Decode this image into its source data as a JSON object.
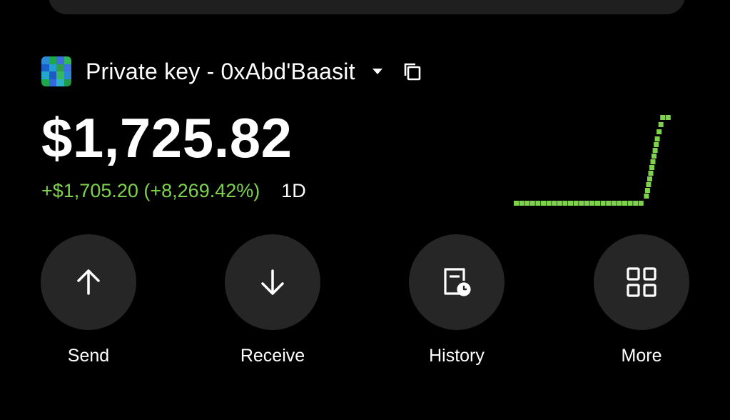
{
  "account": {
    "name": "Private key - 0xAbd'Baasit",
    "avatar_colors": [
      "#2b8bd9",
      "#1fa84a",
      "#3d6fe0",
      "#2fb85a",
      "#1a60c9",
      "#22a0d0",
      "#2e9c4d",
      "#3b73e6",
      "#24a7cf",
      "#1d5bc4",
      "#33b85f",
      "#2a87d6",
      "#1fa84a",
      "#3468de",
      "#2ab2c8",
      "#1e9b48"
    ]
  },
  "balance": "$1,725.82",
  "change": "+$1,705.20 (+8,269.42%)",
  "period": "1D",
  "accent_color": "#7dd34b",
  "actions": [
    {
      "label": "Send",
      "icon": "arrow-up-icon"
    },
    {
      "label": "Receive",
      "icon": "arrow-down-icon"
    },
    {
      "label": "History",
      "icon": "history-icon"
    },
    {
      "label": "More",
      "icon": "grid-icon"
    }
  ],
  "chart_data": {
    "type": "line",
    "x": [
      0,
      1,
      2,
      3,
      4,
      5,
      6,
      7,
      8,
      9,
      10,
      11,
      12,
      13,
      14,
      15,
      16,
      17,
      18,
      19,
      20,
      21,
      22,
      23,
      24,
      25,
      26,
      27,
      28
    ],
    "values": [
      0,
      0,
      0,
      0,
      0,
      0,
      0,
      0,
      0,
      0,
      0,
      0,
      0,
      0,
      0,
      0,
      0,
      0,
      0,
      0,
      0,
      0,
      0,
      0,
      1,
      5,
      9,
      12,
      12
    ]
  }
}
